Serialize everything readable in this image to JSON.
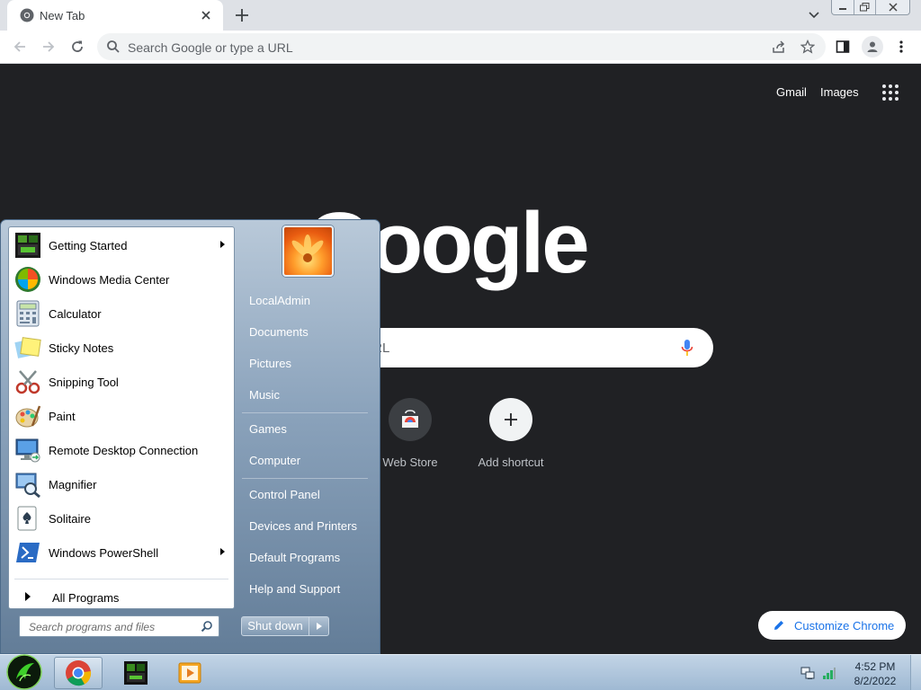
{
  "browser": {
    "tab_title": "New Tab",
    "omnibox_placeholder": "Search Google or type a URL"
  },
  "ntp": {
    "gmail_label": "Gmail",
    "images_label": "Images",
    "logo_text": "Google",
    "search_placeholder_visible": "pe a URL",
    "shortcuts": [
      {
        "label": "Web Store"
      },
      {
        "label": "Add shortcut"
      }
    ],
    "customize_label": "Customize Chrome"
  },
  "start_menu": {
    "pinned": [
      {
        "label": "Getting Started",
        "icon": "getting-started-icon",
        "has_submenu": true
      },
      {
        "label": "Windows Media Center",
        "icon": "media-center-icon",
        "has_submenu": false
      },
      {
        "label": "Calculator",
        "icon": "calculator-icon",
        "has_submenu": false
      },
      {
        "label": "Sticky Notes",
        "icon": "sticky-notes-icon",
        "has_submenu": false
      },
      {
        "label": "Snipping Tool",
        "icon": "snipping-tool-icon",
        "has_submenu": false
      },
      {
        "label": "Paint",
        "icon": "paint-icon",
        "has_submenu": false
      },
      {
        "label": "Remote Desktop Connection",
        "icon": "remote-desktop-icon",
        "has_submenu": false
      },
      {
        "label": "Magnifier",
        "icon": "magnifier-icon",
        "has_submenu": false
      },
      {
        "label": "Solitaire",
        "icon": "solitaire-icon",
        "has_submenu": false
      },
      {
        "label": "Windows PowerShell",
        "icon": "powershell-icon",
        "has_submenu": true
      }
    ],
    "all_programs_label": "All Programs",
    "search_placeholder": "Search programs and files",
    "right_items": [
      "LocalAdmin",
      "Documents",
      "Pictures",
      "Music",
      "Games",
      "Computer",
      "Control Panel",
      "Devices and Printers",
      "Default Programs",
      "Help and Support"
    ],
    "shutdown_label": "Shut down"
  },
  "taskbar": {
    "time": "4:52 PM",
    "date": "8/2/2022"
  }
}
